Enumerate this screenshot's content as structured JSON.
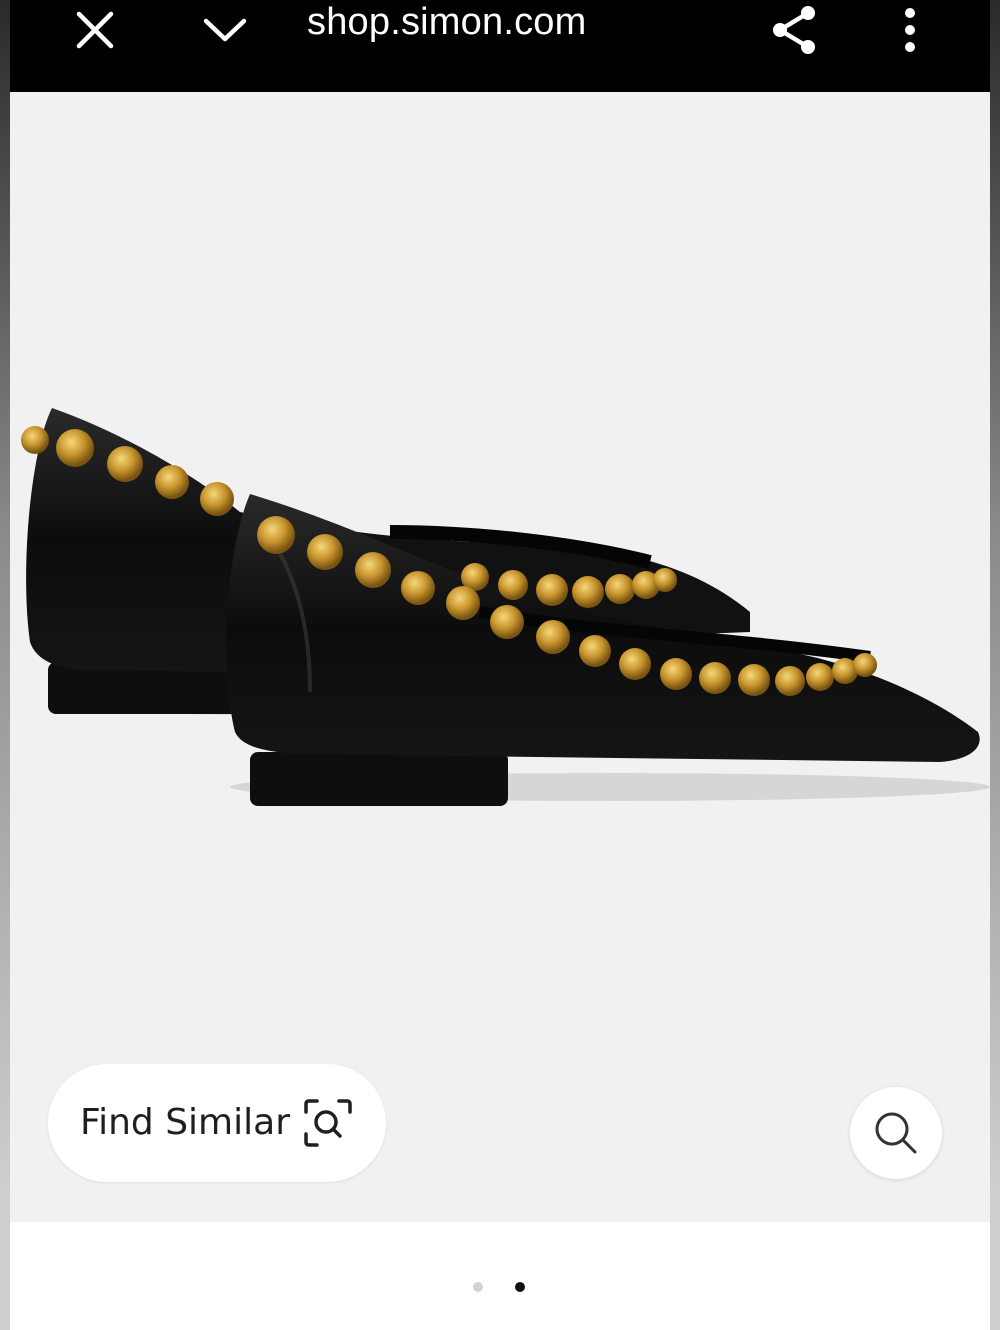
{
  "browser": {
    "url": "shop.simon.com",
    "icons": {
      "close": "close-icon",
      "collapse": "chevron-down-icon",
      "share": "share-icon",
      "menu": "more-vertical-icon"
    },
    "bar_color": "#000000"
  },
  "viewer": {
    "background_color": "#f1f1f1",
    "product_image": "black leather pointed-toe ballet flats with gold stud trim",
    "find_similar_label": "Find Similar",
    "find_similar_icon": "visual-search-icon",
    "search_icon": "search-icon"
  },
  "pagination": {
    "total": 2,
    "current": 2
  }
}
